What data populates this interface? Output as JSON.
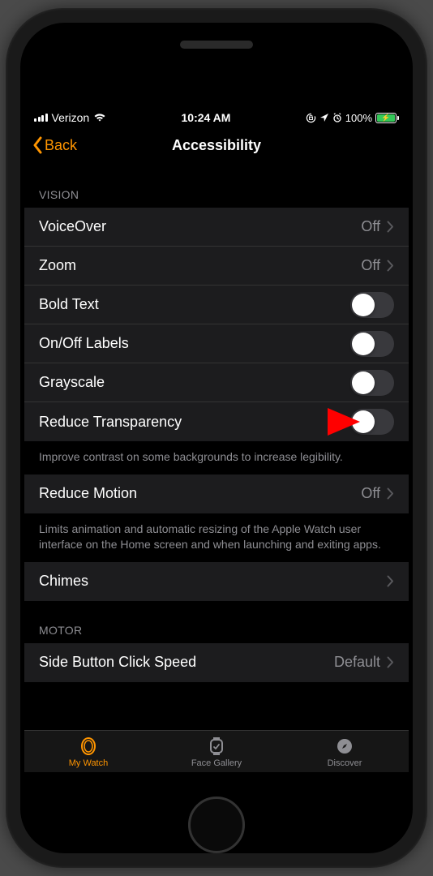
{
  "statusBar": {
    "carrier": "Verizon",
    "time": "10:24 AM",
    "battery": "100%"
  },
  "nav": {
    "back": "Back",
    "title": "Accessibility"
  },
  "sections": {
    "vision": {
      "header": "VISION",
      "voiceover": {
        "label": "VoiceOver",
        "value": "Off"
      },
      "zoom": {
        "label": "Zoom",
        "value": "Off"
      },
      "boldText": {
        "label": "Bold Text"
      },
      "onOffLabels": {
        "label": "On/Off Labels"
      },
      "grayscale": {
        "label": "Grayscale"
      },
      "reduceTransparency": {
        "label": "Reduce Transparency"
      },
      "footer": "Improve contrast on some backgrounds to increase legibility."
    },
    "reduceMotion": {
      "label": "Reduce Motion",
      "value": "Off",
      "footer": "Limits animation and automatic resizing of the Apple Watch user interface on the Home screen and when launching and exiting apps."
    },
    "chimes": {
      "label": "Chimes"
    },
    "motor": {
      "header": "MOTOR",
      "sideButton": {
        "label": "Side Button Click Speed",
        "value": "Default"
      }
    }
  },
  "tabs": {
    "myWatch": "My Watch",
    "faceGallery": "Face Gallery",
    "discover": "Discover"
  }
}
